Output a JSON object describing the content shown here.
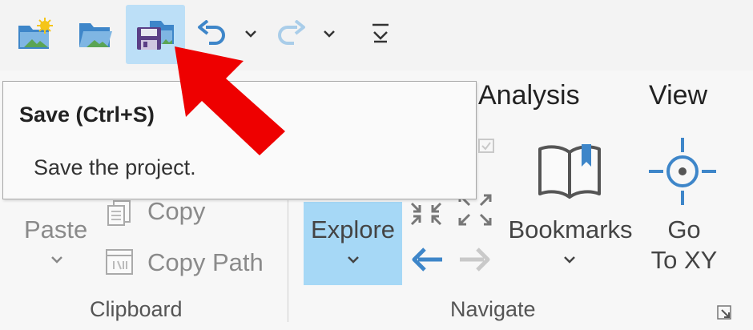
{
  "quick_access": {
    "items": [
      {
        "icon": "new-project-icon"
      },
      {
        "icon": "open-project-icon"
      },
      {
        "icon": "save-project-icon",
        "active": true
      },
      {
        "icon": "undo-icon"
      },
      {
        "icon": "redo-icon"
      },
      {
        "icon": "customize-qat-icon"
      }
    ]
  },
  "tabs": [
    "Analysis",
    "View"
  ],
  "tooltip": {
    "title": "Save (Ctrl+S)",
    "description": "Save the project."
  },
  "clipboard": {
    "paste_label": "Paste",
    "copy_label": "Copy",
    "copy_path_label": "Copy Path",
    "group_label": "Clipboard"
  },
  "navigate": {
    "explore_label": "Explore",
    "bookmarks_label": "Bookmarks",
    "goto_line1": "Go",
    "goto_line2": "To XY",
    "group_label": "Navigate"
  },
  "colors": {
    "accent": "#bcdff7",
    "explore_active": "#a6d8f6",
    "icon_blue": "#3e86c9",
    "pointer_arrow": "#ee0000"
  }
}
